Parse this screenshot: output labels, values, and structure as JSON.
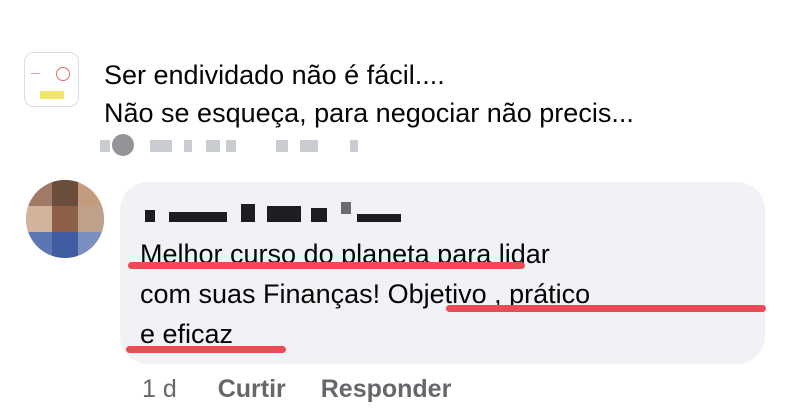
{
  "post": {
    "line1": "Ser endividado não é fácil....",
    "line2": "Não se esqueça, para negociar não precis..."
  },
  "comment": {
    "line1": "Melhor curso do planeta para lidar",
    "line2": "com suas Finanças! Objetivo , prático",
    "line3": "e eficaz"
  },
  "actions": {
    "time": "1 d",
    "like": "Curtir",
    "reply": "Responder"
  },
  "colors": {
    "bubble": "#f0f2f5",
    "highlight": "#ee4a55",
    "muted": "#65676b"
  }
}
